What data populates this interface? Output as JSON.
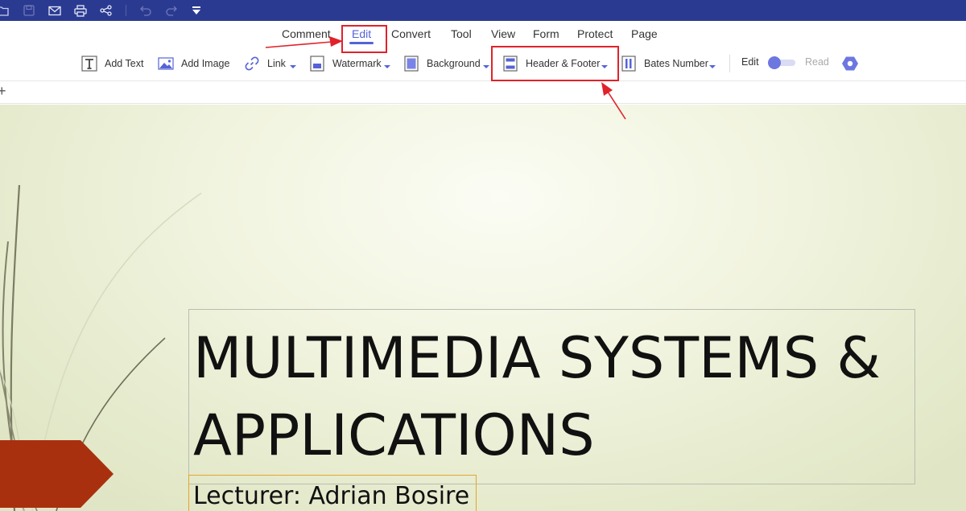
{
  "titlebar": {
    "background": "#2b3a91",
    "icons": [
      "open-icon",
      "save-icon",
      "mail-icon",
      "print-icon",
      "share-icon",
      "undo-icon",
      "redo-icon",
      "quick-access-dropdown-icon"
    ]
  },
  "menu": {
    "items": [
      "Comment",
      "Edit",
      "Convert",
      "Tool",
      "View",
      "Form",
      "Protect",
      "Page"
    ],
    "active": "Edit",
    "accent": "#5563d6"
  },
  "toolbar": {
    "add_text": "Add Text",
    "add_image": "Add Image",
    "link": "Link",
    "watermark": "Watermark",
    "background": "Background",
    "header_footer": "Header & Footer",
    "bates_number": "Bates Number",
    "mode_edit": "Edit",
    "mode_read": "Read"
  },
  "tabstrip": {
    "add_tab": "+"
  },
  "document": {
    "title_line1": "MULTIMEDIA SYSTEMS &",
    "title_line2": "APPLICATIONS",
    "lecturer": "Lecturer: Adrian Bosire",
    "accent_shape_color": "#a9300f"
  },
  "annotations": {
    "highlight_color": "#e0222b"
  }
}
